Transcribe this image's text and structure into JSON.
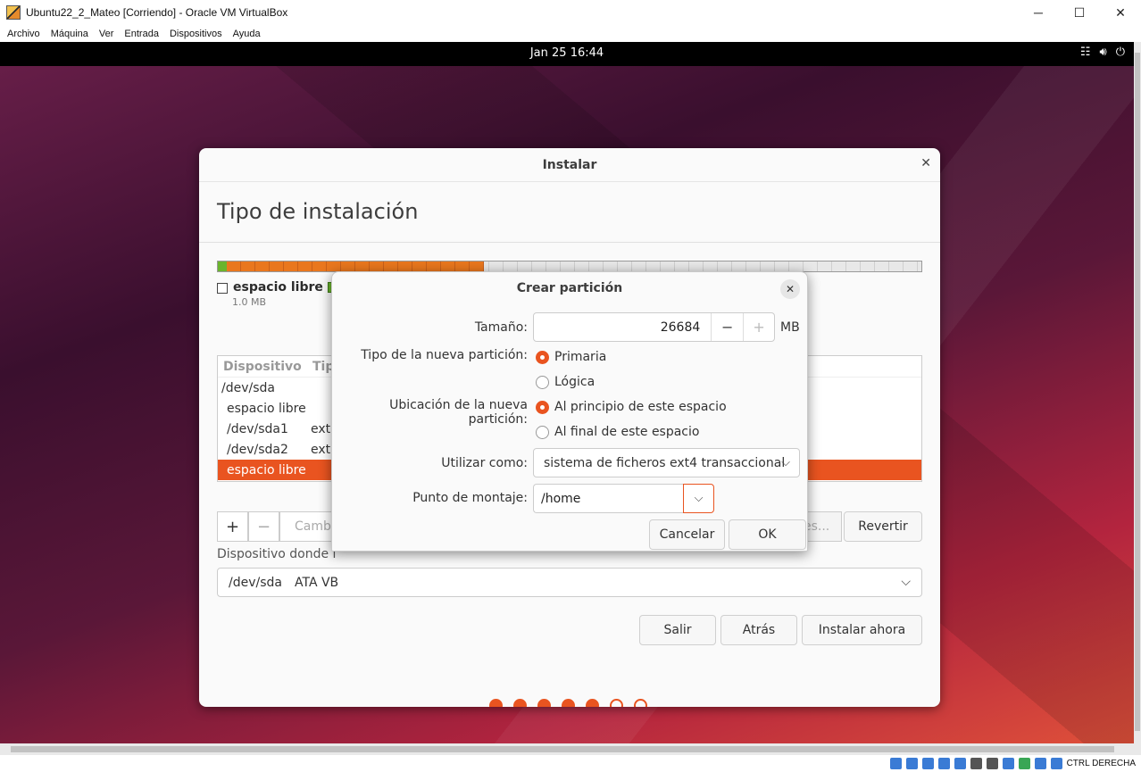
{
  "window": {
    "title": "Ubuntu22_2_Mateo [Corriendo] - Oracle VM VirtualBox",
    "controls": {
      "minimize": "─",
      "maximize": "☐",
      "close": "✕"
    }
  },
  "menubar": [
    "Archivo",
    "Máquina",
    "Ver",
    "Entrada",
    "Dispositivos",
    "Ayuda"
  ],
  "gnome": {
    "clock": "Jan 25  16:44",
    "tray": [
      "network-icon",
      "volume-icon",
      "power-icon"
    ]
  },
  "installer": {
    "title": "Instalar",
    "close": "✕",
    "page_title": "Tipo de instalación",
    "legend": {
      "name": "espacio libre",
      "size": "1.0 MB"
    },
    "table": {
      "headers": [
        "Dispositivo",
        "Tip"
      ],
      "rows": [
        {
          "device": "/dev/sda",
          "type": ""
        },
        {
          "device": "espacio libre",
          "type": ""
        },
        {
          "device": "/dev/sda1",
          "type": "ext"
        },
        {
          "device": "/dev/sda2",
          "type": "ext"
        },
        {
          "device": "espacio libre",
          "type": ""
        }
      ],
      "selected_row": 4
    },
    "tools": {
      "add": "+",
      "remove": "−",
      "change": "Camb",
      "new_table": "es...",
      "revert": "Revertir"
    },
    "boot_label": "Dispositivo donde i",
    "boot_device": {
      "value": "/dev/sda",
      "model": "ATA VB"
    },
    "buttons": {
      "quit": "Salir",
      "back": "Atrás",
      "install": "Instalar ahora"
    },
    "progress": {
      "steps_total": 7,
      "steps_done": 5
    }
  },
  "dialog": {
    "title": "Crear partición",
    "close": "✕",
    "size_label": "Tamaño:",
    "size_value": "26684",
    "size_minus": "−",
    "size_plus": "+",
    "size_unit": "MB",
    "type_label": "Tipo de la nueva partición:",
    "type_options": [
      "Primaria",
      "Lógica"
    ],
    "type_selected": "Primaria",
    "location_label": "Ubicación de la nueva partición:",
    "location_options": [
      "Al principio de este espacio",
      "Al final de este espacio"
    ],
    "location_selected": "Al principio de este espacio",
    "use_as_label": "Utilizar como:",
    "use_as_value": "sistema de ficheros ext4 transaccional",
    "mount_label": "Punto de montaje:",
    "mount_value": "/home",
    "cancel": "Cancelar",
    "ok": "OK"
  },
  "statusbar": {
    "host_key": "CTRL DERECHA"
  },
  "colors": {
    "accent": "#e95420",
    "partition_used": "#e9771e",
    "partition_green": "#6ab42d"
  }
}
